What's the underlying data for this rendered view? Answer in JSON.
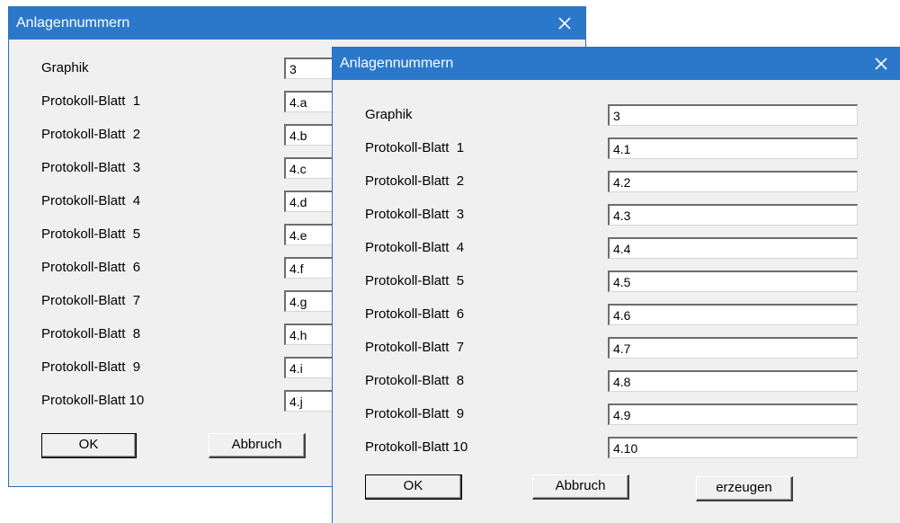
{
  "back_dialog": {
    "title": "Anlagennummern",
    "labels": [
      "Graphik",
      "Protokoll-Blatt  1",
      "Protokoll-Blatt  2",
      "Protokoll-Blatt  3",
      "Protokoll-Blatt  4",
      "Protokoll-Blatt  5",
      "Protokoll-Blatt  6",
      "Protokoll-Blatt  7",
      "Protokoll-Blatt  8",
      "Protokoll-Blatt  9",
      "Protokoll-Blatt 10"
    ],
    "values": [
      "3",
      "4.a",
      "4.b",
      "4.c",
      "4.d",
      "4.e",
      "4.f",
      "4.g",
      "4.h",
      "4.i",
      "4.j"
    ],
    "ok_label": "OK",
    "cancel_label": "Abbruch"
  },
  "front_dialog": {
    "title": "Anlagennummern",
    "labels": [
      "Graphik",
      "Protokoll-Blatt  1",
      "Protokoll-Blatt  2",
      "Protokoll-Blatt  3",
      "Protokoll-Blatt  4",
      "Protokoll-Blatt  5",
      "Protokoll-Blatt  6",
      "Protokoll-Blatt  7",
      "Protokoll-Blatt  8",
      "Protokoll-Blatt  9",
      "Protokoll-Blatt 10"
    ],
    "values": [
      "3",
      "4.1",
      "4.2",
      "4.3",
      "4.4",
      "4.5",
      "4.6",
      "4.7",
      "4.8",
      "4.9",
      "4.10"
    ],
    "ok_label": "OK",
    "cancel_label": "Abbruch",
    "generate_label": "erzeugen"
  },
  "colors": {
    "titlebar": "#2b78cb",
    "dialog_bg": "#f0f0f0",
    "border": "#2d6ec0"
  },
  "icons": {
    "close": "close-icon"
  }
}
